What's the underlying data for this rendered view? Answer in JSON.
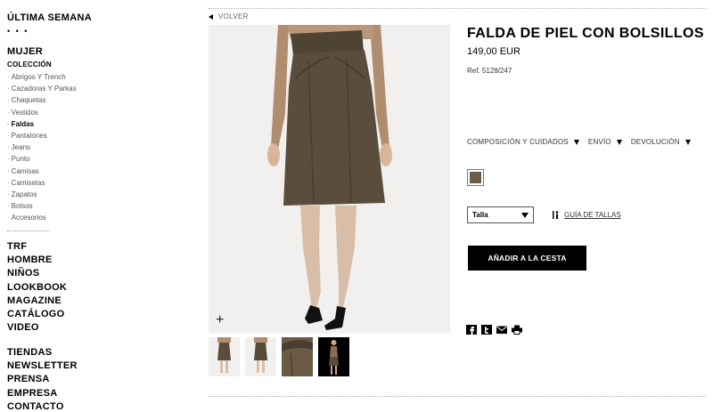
{
  "sidebar": {
    "top_link": "ÚLTIMA SEMANA",
    "dots": "• • •",
    "section": "MUJER",
    "subsection": "COLECCIÓN",
    "categories": [
      {
        "label": "Abrigos Y Trench",
        "active": false
      },
      {
        "label": "Cazadoras Y Parkas",
        "active": false
      },
      {
        "label": "Chaquetas",
        "active": false
      },
      {
        "label": "Vestidos",
        "active": false
      },
      {
        "label": "Faldas",
        "active": true
      },
      {
        "label": "Pantalones",
        "active": false
      },
      {
        "label": "Jeans",
        "active": false
      },
      {
        "label": "Punto",
        "active": false
      },
      {
        "label": "Camisas",
        "active": false
      },
      {
        "label": "Camisetas",
        "active": false
      },
      {
        "label": "Zapatos",
        "active": false
      },
      {
        "label": "Bolsos",
        "active": false
      },
      {
        "label": "Accesorios",
        "active": false
      }
    ],
    "main_nav": [
      "TRF",
      "HOMBRE",
      "NIÑOS",
      "LOOKBOOK",
      "MAGAZINE",
      "CATÁLOGO",
      "VIDEO"
    ],
    "footer_nav": [
      "TIENDAS",
      "NEWSLETTER",
      "PRENSA",
      "EMPRESA",
      "CONTACTO"
    ]
  },
  "back_link": "VOLVER",
  "gallery": {
    "zoom_symbol": "+",
    "thumbnails": [
      "thumb-front",
      "thumb-back",
      "thumb-detail",
      "thumb-model"
    ]
  },
  "product": {
    "title": "FALDA DE PIEL CON BOLSILLOS",
    "price": "149,00 EUR",
    "ref": "Ref. 5128/247",
    "info_links": [
      "COMPOSICIÓN Y CUIDADOS",
      "ENVÍO",
      "DEVOLUCIÓN"
    ],
    "size_select": "Talla",
    "size_guide": "GUÍA DE TALLAS",
    "add_to_cart": "AÑADIR A LA CESTA",
    "share_icons": [
      "facebook-icon",
      "twitter-icon",
      "email-icon",
      "print-icon"
    ]
  },
  "colors": {
    "skirt": "#5b4d3c",
    "sweater": "#b08d6e",
    "swatch": "#6e5c48",
    "photo_bg": "#f1f0ee",
    "button_bg": "#000000"
  }
}
